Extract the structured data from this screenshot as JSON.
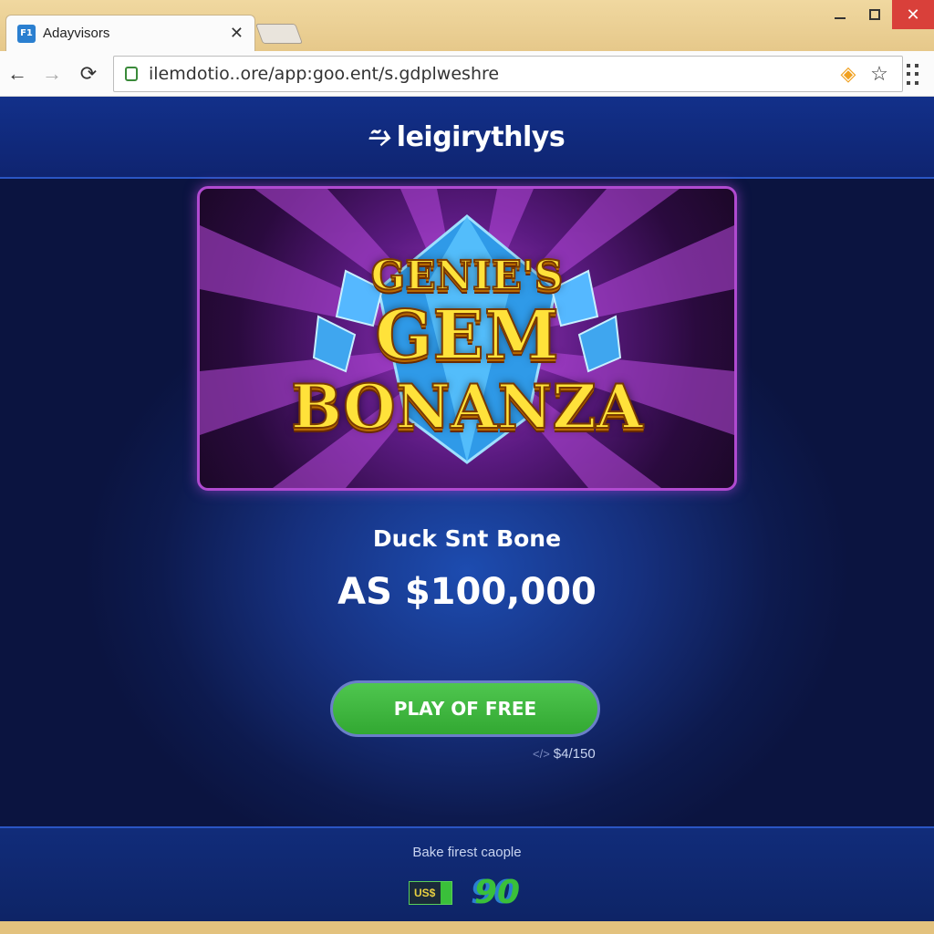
{
  "browser": {
    "tab_title": "Adayvisors",
    "favicon_text": "F1",
    "close_tab_glyph": "✕",
    "url": "ilemdotio..ore/app:goo.ent/s.gdplweshre"
  },
  "site": {
    "brand": "leigirythlys"
  },
  "banner": {
    "line1": "GENIE'S",
    "line2": "GEM",
    "line3": "BONANZA"
  },
  "offer": {
    "label": "Duck Snt Bone",
    "amount": "AS $100,000",
    "play_button": "PLAY OF FREE",
    "sub_price": "$4/150"
  },
  "footer": {
    "text": "Bake firest caople",
    "badge_left": "US$",
    "badge_right": "90"
  },
  "icons": {
    "back": "arrow-left-icon",
    "forward": "arrow-right-icon",
    "reload": "reload-icon",
    "lock": "lock-icon",
    "extension": "extension-icon",
    "bookmark": "star-icon",
    "menu": "menu-dots-icon"
  },
  "colors": {
    "page_bg": "#16307e",
    "play_button": "#3cb83c",
    "banner_title": "#ffe23a",
    "banner_frame": "#b04ad0"
  }
}
